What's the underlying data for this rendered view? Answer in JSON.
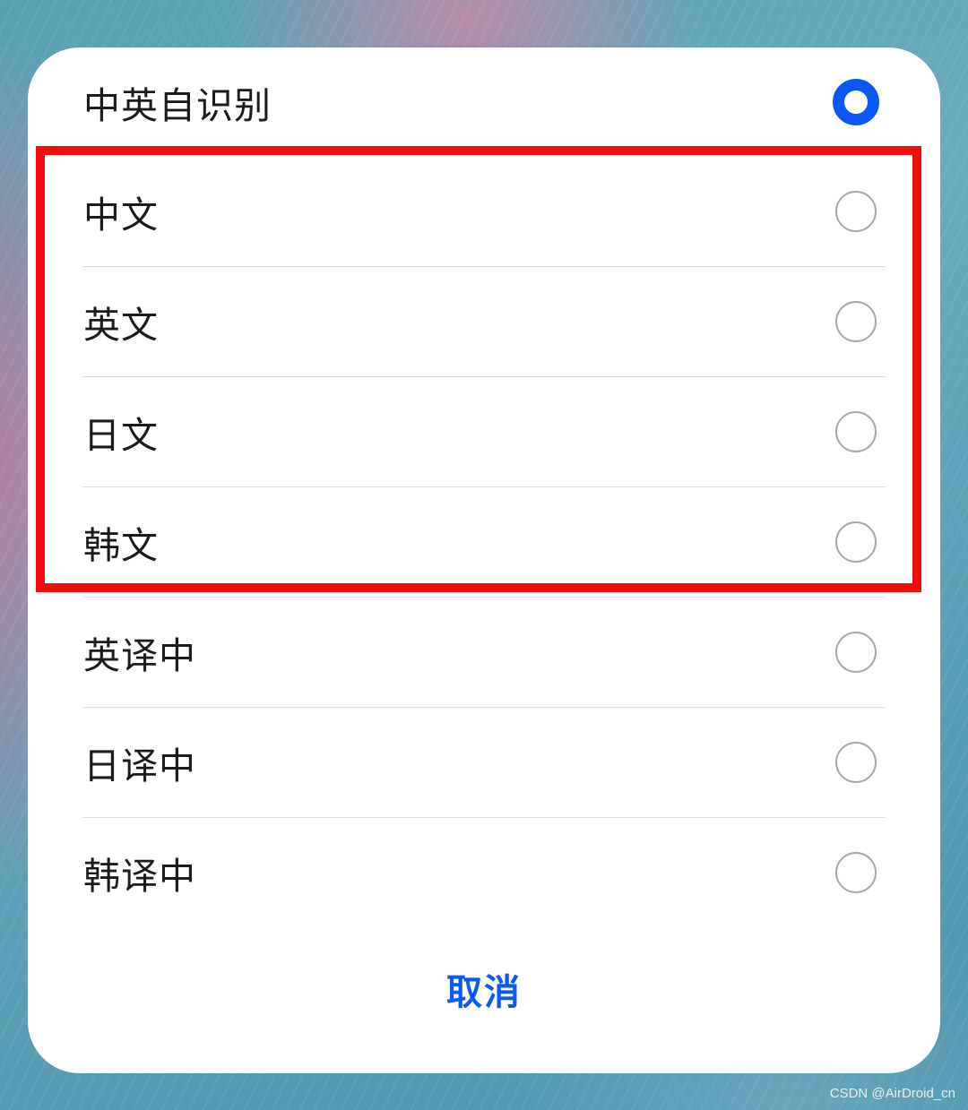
{
  "dialog": {
    "options": [
      {
        "label": "中英自识别",
        "selected": true
      },
      {
        "label": "中文",
        "selected": false
      },
      {
        "label": "英文",
        "selected": false
      },
      {
        "label": "日文",
        "selected": false
      },
      {
        "label": "韩文",
        "selected": false
      },
      {
        "label": "英译中",
        "selected": false
      },
      {
        "label": "日译中",
        "selected": false
      },
      {
        "label": "韩译中",
        "selected": false
      }
    ],
    "cancel_label": "取消"
  },
  "watermark": "CSDN @AirDroid_cn",
  "colors": {
    "accent": "#0a59f7",
    "highlight_box": "#f20c0c",
    "radio_unchecked": "#a8a8a8",
    "divider": "#dcdcdc"
  }
}
